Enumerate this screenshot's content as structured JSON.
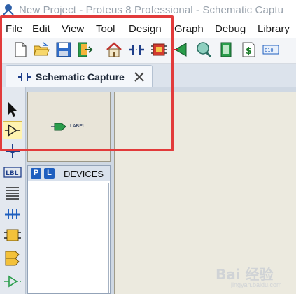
{
  "window": {
    "title": "New Project - Proteus 8 Professional - Schematic Captu"
  },
  "menu": [
    "File",
    "Edit",
    "View",
    "Tool",
    "Design",
    "Graph",
    "Debug",
    "Library"
  ],
  "toolbar": {
    "buttons": [
      "new-document-icon",
      "open-folder-icon",
      "save-disk-icon",
      "close-project-icon",
      "home-page-icon",
      "schematic-capture-icon",
      "pcb-layout-icon",
      "3d-visualizer-icon",
      "gerber-viewer-icon",
      "design-explorer-icon",
      "bill-of-materials-icon",
      "source-code-icon"
    ]
  },
  "tab": {
    "label": "Schematic Capture"
  },
  "mode_tools": [
    "selection-mode-icon",
    "component-mode-icon",
    "junction-dot-icon",
    "wire-label-icon",
    "text-script-icon",
    "buses-mode-icon",
    "subcircuit-icon",
    "terminals-icon",
    "device-pin-icon"
  ],
  "preview": {
    "object_label": "LABEL"
  },
  "devices_panel": {
    "pick_label": "P",
    "library_label": "L",
    "title": "DEVICES"
  },
  "watermark": {
    "text": "Bai 经验",
    "url": "jingyan.baidu.com"
  },
  "colors": {
    "highlight": "#e23b3b",
    "accent": "#1f5fbf",
    "grid_bg": "#eceadf"
  }
}
